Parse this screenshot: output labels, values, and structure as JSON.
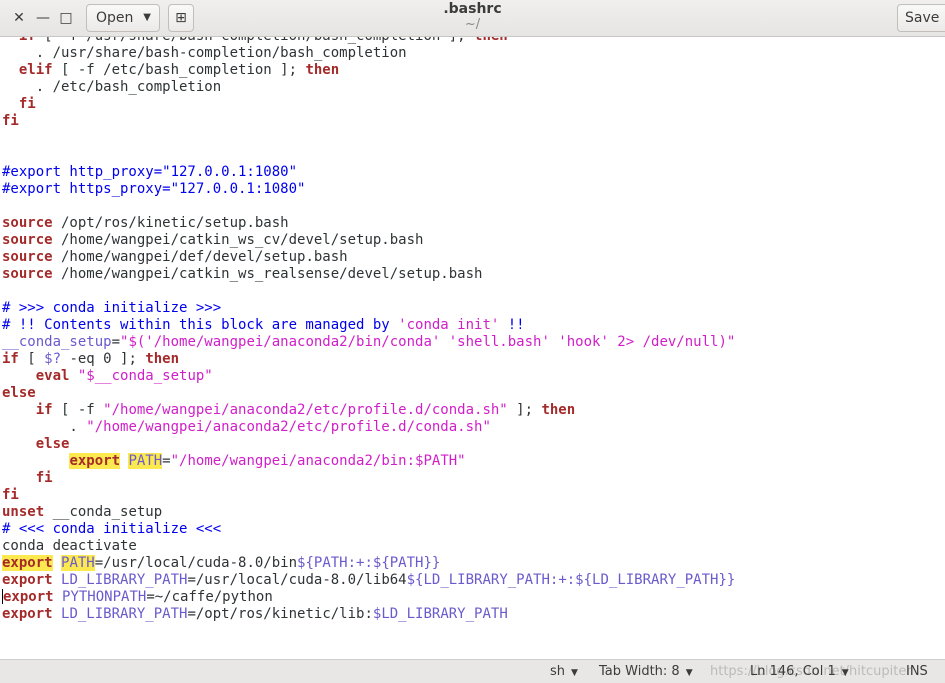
{
  "window": {
    "title": ".bashrc",
    "subtitle": "~/",
    "open_label": "Open",
    "save_label": "Save",
    "minimize_glyph": "—",
    "maximize_glyph": "□",
    "close_glyph": "✕",
    "new_tab_glyph": "⊞"
  },
  "editor": {
    "lines": [
      [
        [
          "k",
          "  if"
        ],
        [
          "t",
          " [ -f /usr/share/bash-completion/bash_completion ]; "
        ],
        [
          "k",
          "then"
        ]
      ],
      [
        [
          "t",
          "    . /usr/share/bash-completion/bash_completion"
        ]
      ],
      [
        [
          "k",
          "  elif"
        ],
        [
          "t",
          " [ -f /etc/bash_completion ]; "
        ],
        [
          "k",
          "then"
        ]
      ],
      [
        [
          "t",
          "    . /etc/bash_completion"
        ]
      ],
      [
        [
          "k",
          "  fi"
        ]
      ],
      [
        [
          "k",
          "fi"
        ]
      ],
      [],
      [],
      [
        [
          "c",
          "#export http_proxy=\"127.0.0.1:1080\""
        ]
      ],
      [
        [
          "c",
          "#export https_proxy=\"127.0.0.1:1080\""
        ]
      ],
      [],
      [
        [
          "k",
          "source"
        ],
        [
          "t",
          " /opt/ros/kinetic/setup.bash"
        ]
      ],
      [
        [
          "k",
          "source"
        ],
        [
          "t",
          " /home/wangpei/catkin_ws_cv/devel/setup.bash"
        ]
      ],
      [
        [
          "k",
          "source"
        ],
        [
          "t",
          " /home/wangpei/def/devel/setup.bash"
        ]
      ],
      [
        [
          "k",
          "source"
        ],
        [
          "t",
          " /home/wangpei/catkin_ws_realsense/devel/setup.bash"
        ]
      ],
      [],
      [
        [
          "c",
          "# >>> conda initialize >>>"
        ]
      ],
      [
        [
          "c",
          "# !! Contents within this block are managed by "
        ],
        [
          "s",
          "'conda init'"
        ],
        [
          "c",
          " !!"
        ]
      ],
      [
        [
          "v",
          "__conda_setup"
        ],
        [
          "t",
          "="
        ],
        [
          "s",
          "\"$('/home/wangpei/anaconda2/bin/conda' 'shell.bash' 'hook' 2> /dev/null)\""
        ]
      ],
      [
        [
          "k",
          "if"
        ],
        [
          "t",
          " [ "
        ],
        [
          "v",
          "$?"
        ],
        [
          "t",
          " -eq 0 ]; "
        ],
        [
          "k",
          "then"
        ]
      ],
      [
        [
          "t",
          "    "
        ],
        [
          "k",
          "eval"
        ],
        [
          "t",
          " "
        ],
        [
          "s",
          "\"$__conda_setup\""
        ]
      ],
      [
        [
          "k",
          "else"
        ]
      ],
      [
        [
          "t",
          "    "
        ],
        [
          "k",
          "if"
        ],
        [
          "t",
          " [ -f "
        ],
        [
          "s",
          "\"/home/wangpei/anaconda2/etc/profile.d/conda.sh\""
        ],
        [
          "t",
          " ]; "
        ],
        [
          "k",
          "then"
        ]
      ],
      [
        [
          "t",
          "        . "
        ],
        [
          "s",
          "\"/home/wangpei/anaconda2/etc/profile.d/conda.sh\""
        ]
      ],
      [
        [
          "t",
          "    "
        ],
        [
          "k",
          "else"
        ]
      ],
      [
        [
          "t",
          "        "
        ],
        [
          "khl",
          "export"
        ],
        [
          "t",
          " "
        ],
        [
          "vhl",
          "PATH"
        ],
        [
          "t",
          "="
        ],
        [
          "s",
          "\"/home/wangpei/anaconda2/bin:$PATH\""
        ]
      ],
      [
        [
          "t",
          "    "
        ],
        [
          "k",
          "fi"
        ]
      ],
      [
        [
          "k",
          "fi"
        ]
      ],
      [
        [
          "k",
          "unset"
        ],
        [
          "t",
          " __conda_setup"
        ]
      ],
      [
        [
          "c",
          "# <<< conda initialize <<<"
        ]
      ],
      [
        [
          "t",
          "conda deactivate"
        ]
      ],
      [
        [
          "khl",
          "export"
        ],
        [
          "t",
          " "
        ],
        [
          "vhl",
          "PATH"
        ],
        [
          "t",
          "=/usr/local/cuda-8.0/bin"
        ],
        [
          "v",
          "${PATH:+:${PATH}}"
        ]
      ],
      [
        [
          "k",
          "export"
        ],
        [
          "t",
          " "
        ],
        [
          "v",
          "LD_LIBRARY_PATH"
        ],
        [
          "t",
          "=/usr/local/cuda-8.0/lib64"
        ],
        [
          "v",
          "${LD_LIBRARY_PATH:+:${LD_LIBRARY_PATH}}"
        ]
      ],
      [
        [
          "caret",
          ""
        ],
        [
          "k",
          "export"
        ],
        [
          "t",
          " "
        ],
        [
          "v",
          "PYTHONPATH"
        ],
        [
          "t",
          "=~/caffe/python"
        ]
      ],
      [
        [
          "k",
          "export"
        ],
        [
          "t",
          " "
        ],
        [
          "v",
          "LD_LIBRARY_PATH"
        ],
        [
          "t",
          "=/opt/ros/kinetic/lib:"
        ],
        [
          "v",
          "$LD_LIBRARY_PATH"
        ]
      ]
    ]
  },
  "statusbar": {
    "language": "sh",
    "tab_width": "Tab Width: 8",
    "position": "Ln 146, Col 1",
    "mode": "INS",
    "watermark": "https://blog.csdn.net/hitcupiter"
  }
}
